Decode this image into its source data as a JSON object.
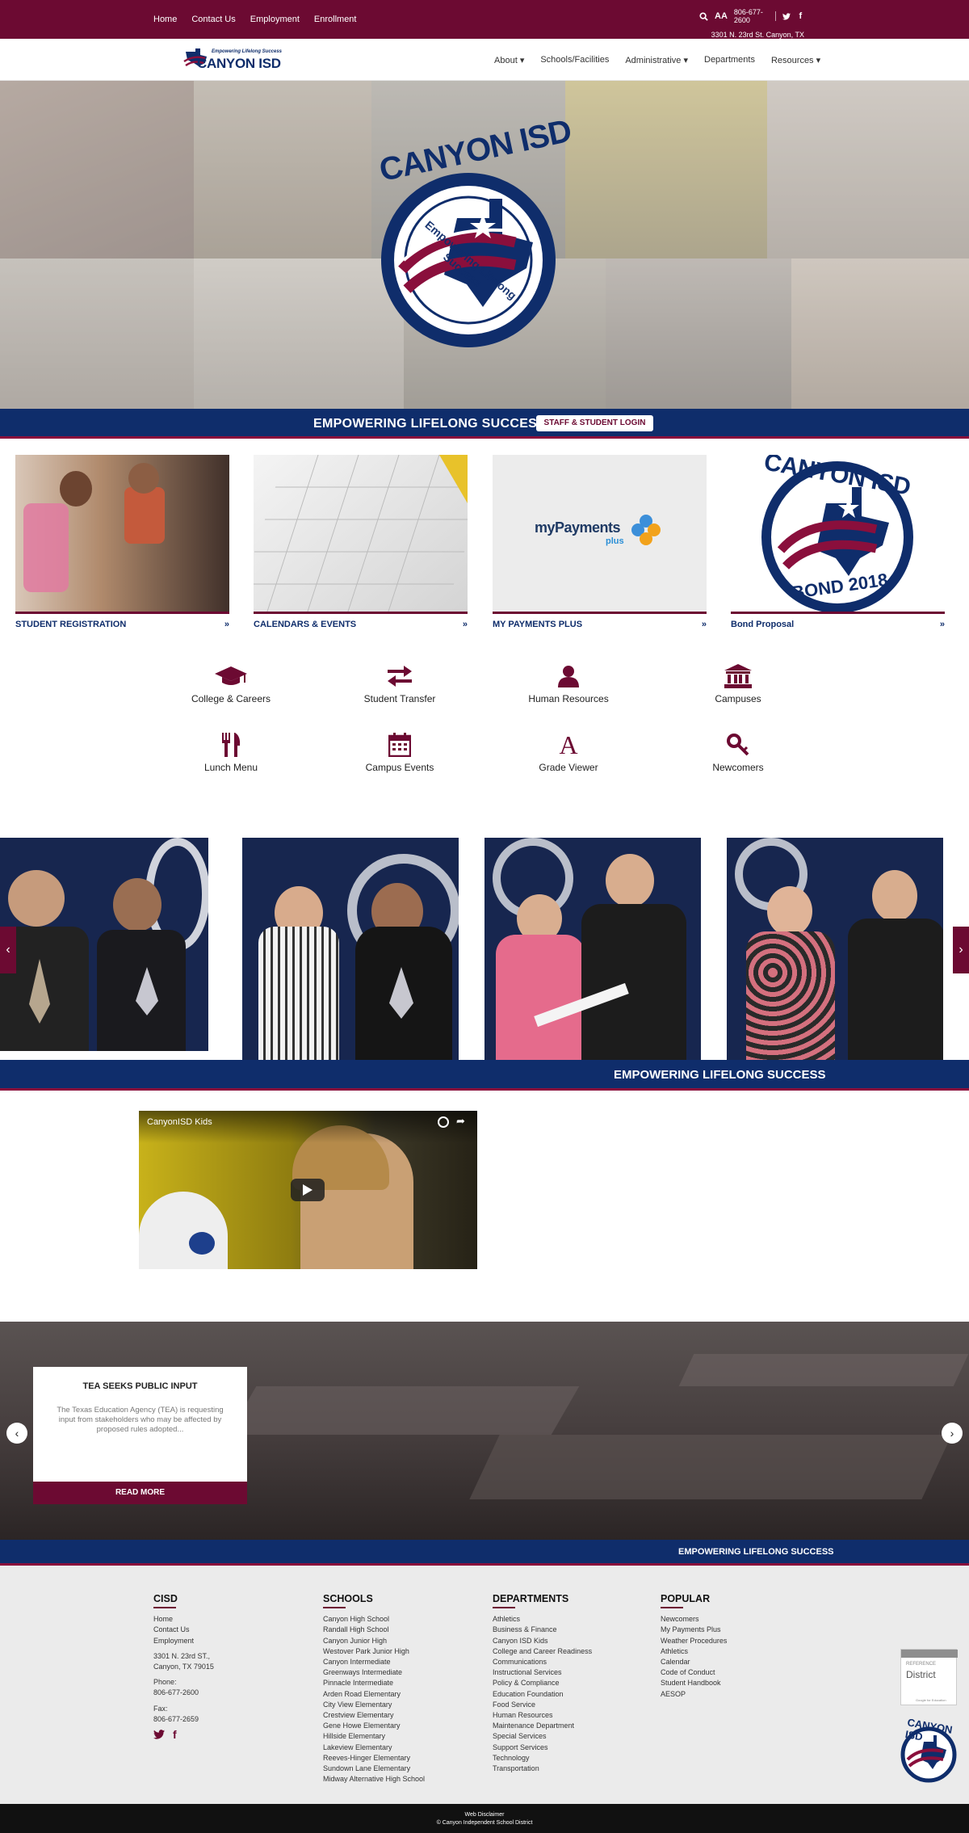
{
  "topbar": {
    "links": [
      "Home",
      "Contact Us",
      "Employment",
      "Enrollment"
    ],
    "font_toggle": "AA",
    "phone": "806-677-2600",
    "address": "3301 N. 23rd St. Canyon, TX 79015"
  },
  "header": {
    "logo_tagline": "Empowering Lifelong Success",
    "logo_text": "CANYON ISD",
    "nav": [
      "About",
      "Schools/Facilities",
      "Administrative",
      "Departments",
      "Resources"
    ]
  },
  "hero": {
    "logo_top": "CANYON ISD",
    "logo_ring": "Empowering Lifelong Success"
  },
  "band1": {
    "text": "EMPOWERING LIFELONG SUCCESS",
    "button": "STAFF & STUDENT LOGIN"
  },
  "cards": [
    {
      "label": "STUDENT REGISTRATION"
    },
    {
      "label": "CALENDARS & EVENTS"
    },
    {
      "label": "MY PAYMENTS PLUS",
      "logo_main": "myPayments",
      "logo_sub": "plus"
    },
    {
      "label": "Bond Proposal",
      "logo_top": "CANYON ISD",
      "logo_bottom": "BOND 2018"
    }
  ],
  "quicklinks": [
    {
      "label": "College & Careers",
      "icon": "graduation-cap-icon"
    },
    {
      "label": "Student Transfer",
      "icon": "exchange-arrows-icon"
    },
    {
      "label": "Human Resources",
      "icon": "user-icon"
    },
    {
      "label": "Campuses",
      "icon": "building-columns-icon"
    },
    {
      "label": "Lunch Menu",
      "icon": "utensils-icon"
    },
    {
      "label": "Campus Events",
      "icon": "calendar-icon"
    },
    {
      "label": "Grade Viewer",
      "icon": "letter-a-icon"
    },
    {
      "label": "Newcomers",
      "icon": "key-icon"
    }
  ],
  "band2": {
    "text": "EMPOWERING LIFELONG SUCCESS"
  },
  "video": {
    "title": "CanyonISD Kids"
  },
  "news": {
    "title": "TEA SEEKS PUBLIC INPUT",
    "body": "The Texas Education Agency (TEA) is requesting input from stakeholders who may be affected by proposed rules adopted...",
    "button": "READ MORE"
  },
  "band3": {
    "text": "EMPOWERING LIFELONG SUCCESS"
  },
  "footer": {
    "cisd": {
      "heading": "CISD",
      "links": [
        "Home",
        "Contact Us",
        "Employment"
      ],
      "address1": "3301 N. 23rd ST.,",
      "address2": "Canyon, TX 79015",
      "phone_label": "Phone:",
      "phone": "806-677-2600",
      "fax_label": "Fax:",
      "fax": "806-677-2659"
    },
    "schools": {
      "heading": "SCHOOLS",
      "links": [
        "Canyon High School",
        "Randall High School",
        "Canyon Junior High",
        "Westover Park Junior High",
        "Canyon Intermediate",
        "Greenways Intermediate",
        "Pinnacle Intermediate",
        "Arden Road Elementary",
        "City View Elementary",
        "Crestview Elementary",
        "Gene Howe Elementary",
        "Hillside Elementary",
        "Lakeview Elementary",
        "Reeves-Hinger Elementary",
        "Sundown Lane Elementary",
        "Midway Alternative High School"
      ]
    },
    "departments": {
      "heading": "DEPARTMENTS",
      "links": [
        "Athletics",
        "Business & Finance",
        "Canyon ISD Kids",
        "College and Career Readiness",
        "Communications",
        "Instructional Services",
        "Policy & Compliance",
        "Education Foundation",
        "Food Service",
        "Human Resources",
        "Maintenance Department",
        "Special Services",
        "Support Services",
        "Technology",
        "Transportation"
      ]
    },
    "popular": {
      "heading": "POPULAR",
      "links": [
        "Newcomers",
        "My Payments Plus",
        "Weather Procedures",
        "Athletics",
        "Calendar",
        "Code of Conduct",
        "Student Handbook",
        "AESOP"
      ]
    },
    "badge": {
      "top": "REFERENCE",
      "main": "District",
      "small": "Google for Education"
    }
  },
  "bottombar": {
    "line1": "Web Disclaimer",
    "line2": "© Canyon Independent School District"
  },
  "colors": {
    "maroon": "#6c0a32",
    "navy": "#0f2d6b"
  }
}
